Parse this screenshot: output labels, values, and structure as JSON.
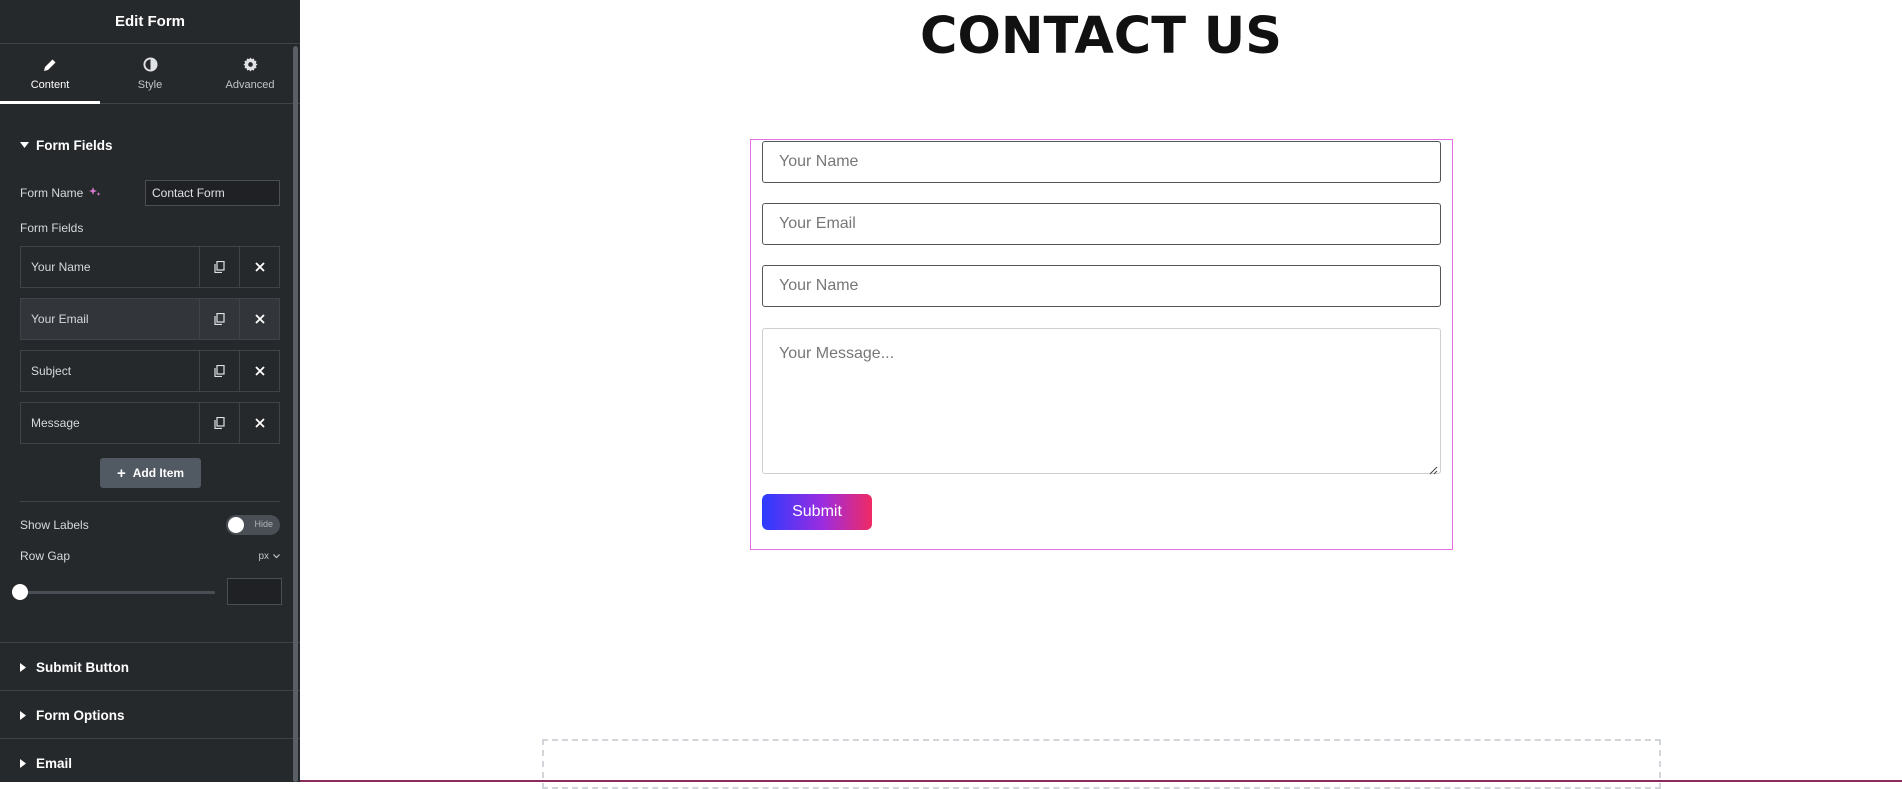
{
  "sidebar": {
    "title": "Edit Form",
    "tabs": [
      {
        "label": "Content",
        "icon": "pencil-icon"
      },
      {
        "label": "Style",
        "icon": "contrast-icon"
      },
      {
        "label": "Advanced",
        "icon": "gear-icon"
      }
    ],
    "form_fields_section": "Form Fields",
    "form_name_label": "Form Name",
    "form_name_value": "Contact Form",
    "form_fields_label": "Form Fields",
    "fields": [
      {
        "label": "Your Name"
      },
      {
        "label": "Your Email"
      },
      {
        "label": "Subject"
      },
      {
        "label": "Message"
      }
    ],
    "add_item_label": "Add Item",
    "show_labels_label": "Show Labels",
    "show_labels_toggle": "Hide",
    "row_gap_label": "Row Gap",
    "row_gap_unit": "px",
    "sections": [
      {
        "label": "Submit Button"
      },
      {
        "label": "Form Options"
      },
      {
        "label": "Email"
      }
    ]
  },
  "canvas": {
    "title": "CONTACT US",
    "fields": [
      {
        "placeholder": "Your Name"
      },
      {
        "placeholder": "Your Email"
      },
      {
        "placeholder": "Your Name"
      }
    ],
    "message_placeholder": "Your Message...",
    "submit_label": "Submit"
  },
  "colors": {
    "sidebar_bg": "#26292c",
    "form_outline": "#e86ee6",
    "submit_gradient_start": "#2b3cff",
    "submit_gradient_end": "#f02a64"
  }
}
